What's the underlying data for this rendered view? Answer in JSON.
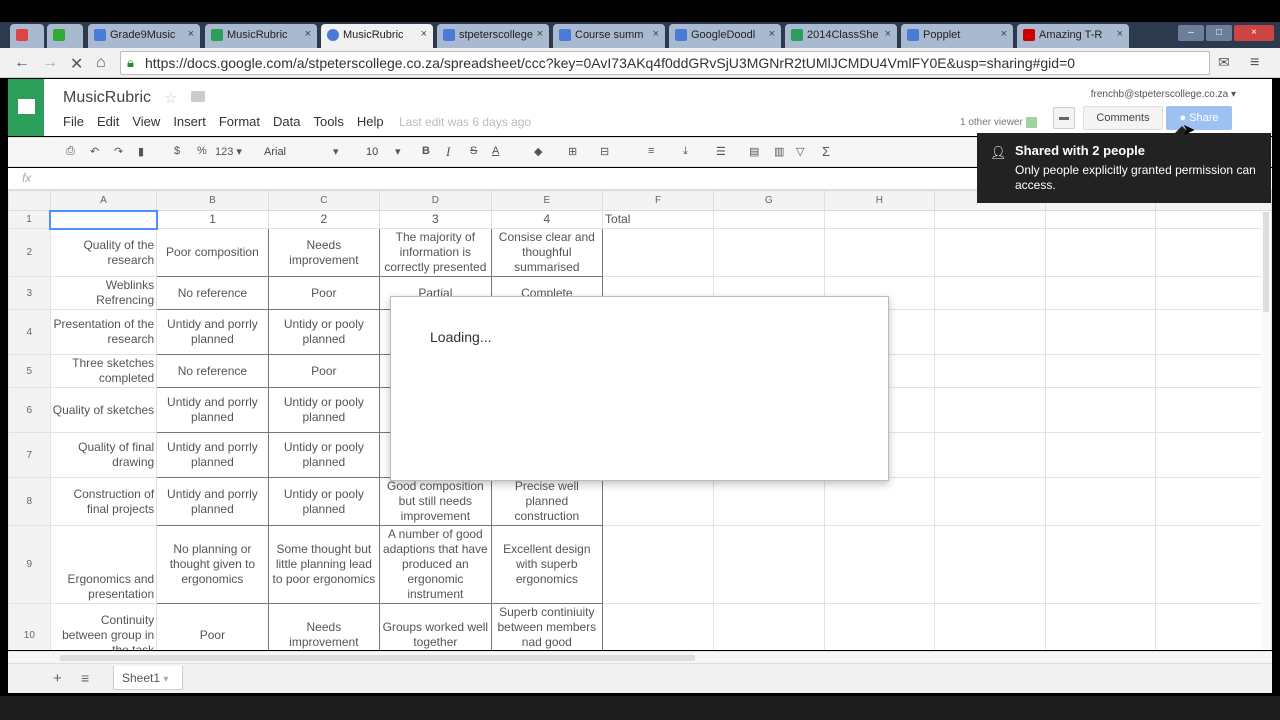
{
  "browser": {
    "tabs": [
      {
        "label": "",
        "icon": "gmail-icon",
        "color": "#d44"
      },
      {
        "label": "",
        "icon": "drive-icon",
        "color": "#3a3"
      },
      {
        "label": "Grade9Music",
        "icon": "doc-icon",
        "color": "#4a7bd6"
      },
      {
        "label": "MusicRubric",
        "icon": "sheet-icon",
        "color": "#2d9e5a"
      },
      {
        "label": "MusicRubric",
        "icon": "loading-icon",
        "color": "#4a7bd6"
      },
      {
        "label": "stpeterscollege",
        "icon": "sites-icon",
        "color": "#4a7bd6"
      },
      {
        "label": "Course summ",
        "icon": "classroom-icon",
        "color": "#4a7bd6"
      },
      {
        "label": "GoogleDoodl",
        "icon": "doc-icon",
        "color": "#4a7bd6"
      },
      {
        "label": "2014ClassShe",
        "icon": "sheet-icon",
        "color": "#2d9e5a"
      },
      {
        "label": "Popplet",
        "icon": "popplet-icon",
        "color": "#4a7bd6"
      },
      {
        "label": "Amazing T-R",
        "icon": "youtube-icon",
        "color": "#c00"
      }
    ],
    "url": "https://docs.google.com/a/stpeterscollege.co.za/spreadsheet/ccc?key=0AvI73AKq4f0ddGRvSjU3MGNrR2tUMlJCMDU4VmlFY0E&usp=sharing#gid=0"
  },
  "doc": {
    "title": "MusicRubric",
    "menus": [
      "File",
      "Edit",
      "View",
      "Insert",
      "Format",
      "Data",
      "Tools",
      "Help"
    ],
    "last_edit": "Last edit was 6 days ago",
    "email": "frenchb@stpeterscollege.co.za ▾",
    "viewers": "1 other viewer",
    "comments_label": "Comments",
    "share_label": "Share"
  },
  "toolbar": {
    "currency": "$",
    "percent": "%",
    "number_format": "123 ▾",
    "font": "Arial",
    "font_size": "10",
    "bold": "B",
    "italic": "I",
    "strike": "S",
    "text_color": "A",
    "sigma": "Σ"
  },
  "formula_bar": {
    "fx_label": "fx"
  },
  "grid": {
    "col_headers": [
      "A",
      "B",
      "C",
      "D",
      "E",
      "F",
      "G",
      "H"
    ],
    "row1": [
      "",
      "1",
      "2",
      "3",
      "4",
      "Total"
    ],
    "rows": [
      {
        "num": "2",
        "cells": [
          "Quality of the research",
          "Poor composition",
          "Needs improvement",
          "The majority of information is correctly presented",
          "Consise clear and thoughful summarised"
        ]
      },
      {
        "num": "3",
        "cells": [
          "Weblinks Refrencing",
          "No reference",
          "Poor",
          "Partial",
          "Complete"
        ]
      },
      {
        "num": "4",
        "cells": [
          "Presentation of the research",
          "Untidy and porrly planned",
          "Untidy or pooly planned",
          "",
          ""
        ]
      },
      {
        "num": "5",
        "cells": [
          "Three sketches completed",
          "No reference",
          "Poor",
          "",
          ""
        ]
      },
      {
        "num": "6",
        "cells": [
          "Quality of sketches",
          "Untidy and porrly planned",
          "Untidy or pooly planned",
          "",
          ""
        ]
      },
      {
        "num": "7",
        "cells": [
          "Quality of final drawing",
          "Untidy and porrly planned",
          "Untidy or pooly planned",
          "",
          ""
        ]
      },
      {
        "num": "8",
        "cells": [
          "Construction of final projects",
          "Untidy and porrly planned",
          "Untidy or pooly planned",
          "Good composition but still needs improvement",
          "Precise well planned construction"
        ]
      },
      {
        "num": "9",
        "cells": [
          "Ergonomics and presentation",
          "No planning or thought given to ergonomics",
          "Some thought but little planning lead to poor ergonomics",
          "A number of good adaptions that have produced an ergonomic instrument",
          "Excellent design with superb ergonomics"
        ]
      },
      {
        "num": "10",
        "cells": [
          "Continuity between group in the task",
          "Poor",
          "Needs improvement",
          "Groups worked well together",
          "Superb continiuity between members nad good leadership shown"
        ]
      }
    ]
  },
  "sheet_tab": "Sheet1",
  "dialog": {
    "text": "Loading..."
  },
  "tooltip": {
    "title": "Shared with 2 people",
    "body": "Only people explicitly granted permission can access."
  }
}
